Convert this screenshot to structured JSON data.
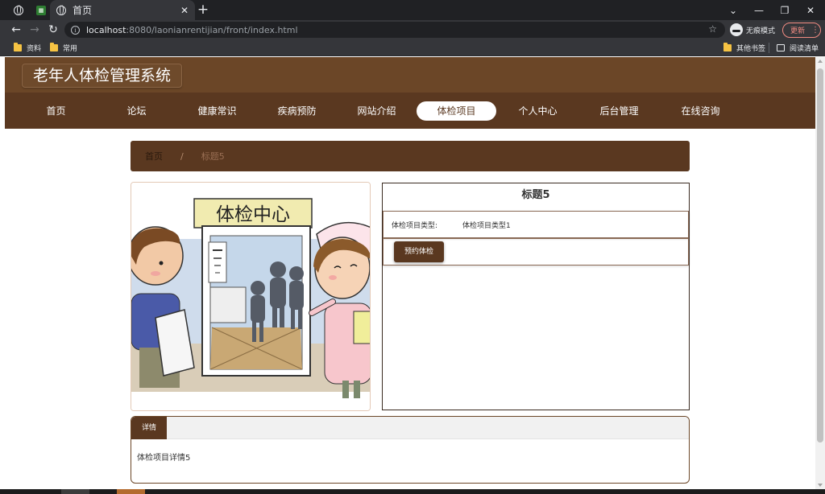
{
  "browser": {
    "active_tab_title": "首页",
    "url_host": "localhost",
    "url_rest": ":8080/laonianrentijian/front/index.html",
    "incognito_label": "无痕模式",
    "update_label": "更新",
    "bookmarks": [
      "资料",
      "常用"
    ],
    "other_bookmarks": "其他书签",
    "reading_list": "阅读清单"
  },
  "site": {
    "title": "老年人体检管理系统",
    "nav": [
      "首页",
      "论坛",
      "健康常识",
      "疾病预防",
      "网站介绍",
      "体检项目",
      "个人中心",
      "后台管理",
      "在线咨询"
    ],
    "active_nav": "体检项目"
  },
  "breadcrumb": {
    "home": "首页",
    "separator": "/",
    "current": "标题5"
  },
  "image": {
    "sign_text": "体检中心"
  },
  "detail": {
    "title": "标题5",
    "type_label": "体检项目类型:",
    "type_value": "体检项目类型1",
    "book_button": "预约体检"
  },
  "description": {
    "tab_label": "详情",
    "content": "体检项目详情5"
  },
  "colors": {
    "header": "#6b4627",
    "nav": "#5a3820",
    "accent": "#5a3820"
  }
}
